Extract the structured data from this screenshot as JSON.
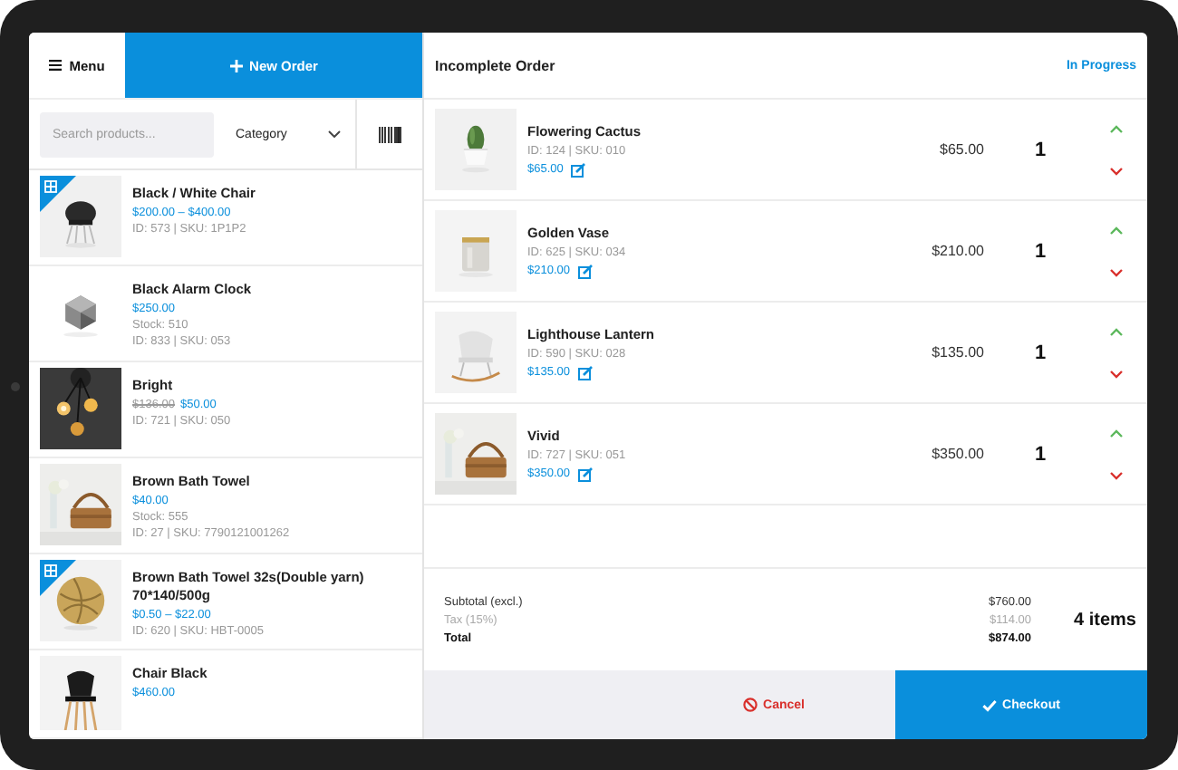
{
  "header": {
    "menu_label": "Menu",
    "new_order_label": "New Order"
  },
  "filters": {
    "search_placeholder": "Search products...",
    "category": "Category"
  },
  "products": [
    {
      "name": "Black / White Chair",
      "price": "$200.00 – $400.00",
      "meta": "ID: 573 | SKU: 1P1P2",
      "variable": true
    },
    {
      "name": "Black Alarm Clock",
      "price": "$250.00",
      "stock": "Stock: 510",
      "meta": "ID: 833 | SKU: 053",
      "variable": false
    },
    {
      "name": "Bright",
      "old_price": "$136.00",
      "price": "$50.00",
      "meta": "ID: 721 | SKU: 050",
      "variable": false
    },
    {
      "name": "Brown Bath Towel",
      "price": "$40.00",
      "stock": "Stock: 555",
      "meta": "ID: 27 | SKU: 7790121001262",
      "variable": false
    },
    {
      "name": "Brown Bath Towel 32s(Double yarn) 70*140/500g",
      "price": "$0.50 – $22.00",
      "meta": "ID: 620 | SKU: HBT-0005",
      "variable": true
    },
    {
      "name": "Chair Black",
      "price": "$460.00",
      "variable": false
    }
  ],
  "order": {
    "title": "Incomplete Order",
    "status": "In Progress",
    "lines": [
      {
        "name": "Flowering Cactus",
        "meta": "ID: 124 | SKU: 010",
        "unit_price": "$65.00",
        "line_total": "$65.00",
        "qty": "1"
      },
      {
        "name": "Golden Vase",
        "meta": "ID: 625 | SKU: 034",
        "unit_price": "$210.00",
        "line_total": "$210.00",
        "qty": "1"
      },
      {
        "name": "Lighthouse Lantern",
        "meta": "ID: 590 | SKU: 028",
        "unit_price": "$135.00",
        "line_total": "$135.00",
        "qty": "1"
      },
      {
        "name": "Vivid",
        "meta": "ID: 727 | SKU: 051",
        "unit_price": "$350.00",
        "line_total": "$350.00",
        "qty": "1"
      }
    ],
    "totals": [
      {
        "kind": "subtotal",
        "label": "Subtotal (excl.)",
        "value": "$760.00"
      },
      {
        "kind": "tax",
        "label": "Tax (15%)",
        "value": "$114.00"
      },
      {
        "kind": "total",
        "label": "Total",
        "value": "$874.00"
      }
    ],
    "item_count": "4 items"
  },
  "actions": {
    "cancel": "Cancel",
    "checkout": "Checkout"
  }
}
